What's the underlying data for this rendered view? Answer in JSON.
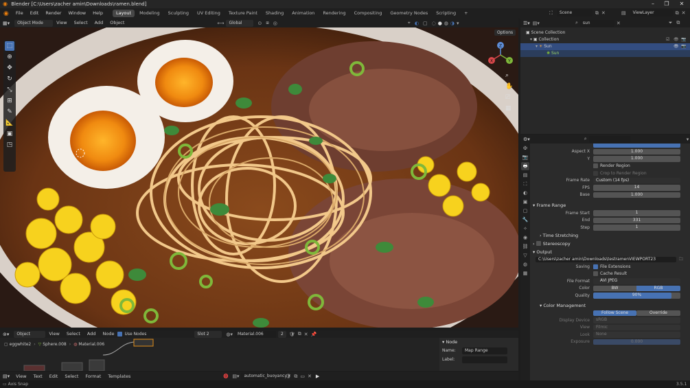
{
  "window": {
    "title": "Blender [C:\\Users\\zacher amin\\Downloads\\ramen.blend]",
    "controls": [
      "–",
      "❐",
      "✕"
    ]
  },
  "menubar": {
    "menus": [
      "File",
      "Edit",
      "Render",
      "Window",
      "Help"
    ],
    "workspaces": [
      "Layout",
      "Modeling",
      "Sculpting",
      "UV Editing",
      "Texture Paint",
      "Shading",
      "Animation",
      "Rendering",
      "Compositing",
      "Geometry Nodes",
      "Scripting"
    ],
    "active_workspace": "Layout",
    "add_tab": "+",
    "scene_value": "Scene",
    "viewlayer_value": "ViewLayer"
  },
  "viewport_header": {
    "mode": "Object Mode",
    "menus": [
      "View",
      "Select",
      "Add",
      "Object"
    ],
    "orientation": "Global",
    "options_label": "Options"
  },
  "toolbar": {
    "tools": [
      "select-box",
      "cursor",
      "move",
      "rotate",
      "scale",
      "transform",
      "annotate",
      "measure",
      "add-cube"
    ],
    "active_tool": "select-box"
  },
  "nav_gizmo": {
    "axes": [
      "X",
      "Y",
      "Z"
    ]
  },
  "node_editor": {
    "header": {
      "type": "Object",
      "menus": [
        "View",
        "Select",
        "Add",
        "Node"
      ],
      "use_nodes_label": "Use Nodes",
      "use_nodes": true,
      "slot": "Slot 2",
      "material": "Material.006",
      "users": "2"
    },
    "breadcrumb": [
      "eggwhite2",
      "Sphere.008",
      "Material.006"
    ],
    "panel": {
      "tab": "Node",
      "name_label": "Name:",
      "name_value": "Map Range",
      "label_label": "Label:",
      "label_value": ""
    }
  },
  "text_editor": {
    "menus": [
      "View",
      "Text",
      "Edit",
      "Select",
      "Format",
      "Templates"
    ],
    "text_name": "automatic_buoyancy"
  },
  "status_bar": {
    "left": "Axis Snap",
    "version": "3.5.1"
  },
  "outliner": {
    "search": "sun",
    "rows": [
      {
        "label": "Scene Collection",
        "indent": 0,
        "selected": false
      },
      {
        "label": "Collection",
        "indent": 1,
        "selected": false
      },
      {
        "label": "Sun",
        "indent": 2,
        "selected": true
      },
      {
        "label": "Sun",
        "indent": 3,
        "selected": true
      }
    ]
  },
  "properties": {
    "rows_top": [
      {
        "label": "Aspect X",
        "value": "1.000"
      },
      {
        "label": "Y",
        "value": "1.000"
      }
    ],
    "render_region": "Render Region",
    "crop_region": "Crop to Render Region",
    "frame_rate_label": "Frame Rate",
    "frame_rate": "Custom (14 fps)",
    "fps_label": "FPS",
    "fps": "14",
    "base_label": "Base",
    "base": "1.000",
    "frame_range_title": "Frame Range",
    "frame_start_label": "Frame Start",
    "frame_start": "1",
    "end_label": "End",
    "end": "331",
    "step_label": "Step",
    "step": "1",
    "time_stretching": "Time Stretching",
    "stereoscopy": "Stereoscopy",
    "output_title": "Output",
    "output_path": "C:\\Users\\zacher amin\\Downloads\\testramenVIEWPORT23",
    "saving_label": "Saving",
    "file_extensions": "File Extensions",
    "cache_result": "Cache Result",
    "file_format_label": "File Format",
    "file_format": "AVI JPEG",
    "color_label": "Color",
    "color_bw": "BW",
    "color_rgb": "RGB",
    "quality_label": "Quality",
    "quality": "90%",
    "quality_fraction": 0.9,
    "color_management": "Color Management",
    "follow_scene": "Follow Scene",
    "override": "Override",
    "display_device_label": "Display Device",
    "display_device": "sRGB",
    "view_label": "View",
    "view": "Filmic",
    "look_label": "Look",
    "look": "None",
    "exposure_label": "Exposure",
    "exposure": "0.000"
  },
  "colors": {
    "accent": "#4772b3",
    "selected_row": "#334d80",
    "bg": "#1d1d1d",
    "panel": "#2b2b2b"
  }
}
